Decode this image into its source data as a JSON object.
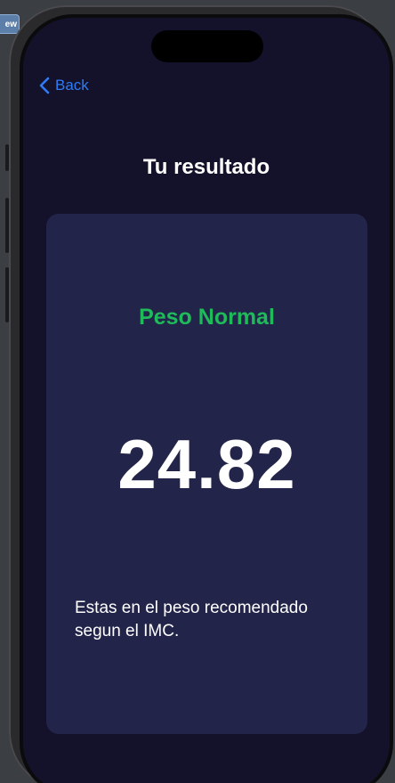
{
  "colors": {
    "accent": "#2f7bf5",
    "status_normal": "#1fba5a",
    "background": "#13122a",
    "card": "#23244a",
    "text": "#ffffff"
  },
  "toolbar": {
    "preview_label": "ew"
  },
  "nav": {
    "back_label": "Back",
    "back_icon": "chevron-left-icon"
  },
  "header": {
    "title": "Tu resultado"
  },
  "result": {
    "status": "Peso Normal",
    "bmi_value": "24.82",
    "description": "Estas en el peso recomendado segun el IMC."
  }
}
